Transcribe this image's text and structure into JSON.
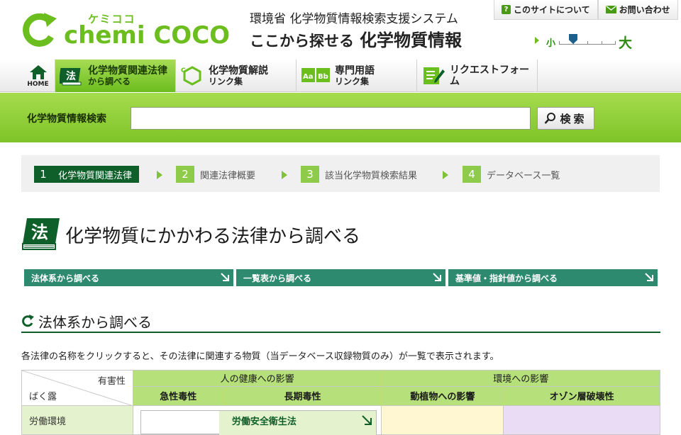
{
  "header": {
    "logo_kana": "ケミココ",
    "logo_word": "chemi COCO",
    "system_title": "環境省 化学物質情報検索支援システム",
    "tagline": "ここから探せる",
    "tagline_big": "化学物質情報",
    "top_links": [
      {
        "label": "このサイトについて",
        "icon": "question-icon"
      },
      {
        "label": "お問い合わせ",
        "icon": "mail-icon"
      }
    ],
    "font_size": {
      "small": "小",
      "large": "大"
    }
  },
  "nav": {
    "home": "HOME",
    "items": [
      {
        "line1": "化学物質関連法律",
        "line2": "から調べる",
        "icon": "law-book-icon"
      },
      {
        "line1": "化学物質解説",
        "line2": "リンク集",
        "icon": "hexagon-icon"
      },
      {
        "line1": "専門用語",
        "line2": "リンク集",
        "icon": "abc-book-icon"
      },
      {
        "line1": "リクエストフォーム",
        "line2": "",
        "icon": "form-pencil-icon"
      }
    ]
  },
  "search": {
    "label": "化学物質情報検索",
    "value": "",
    "button": "検索"
  },
  "steps": [
    {
      "num": "1",
      "label": "化学物質関連法律"
    },
    {
      "num": "2",
      "label": "関連法律概要"
    },
    {
      "num": "3",
      "label": "該当化学物質検索結果"
    },
    {
      "num": "4",
      "label": "データベース一覧"
    }
  ],
  "page_title": "化学物質にかかわる法律から調べる",
  "anchors": [
    "法体系から調べる",
    "一覧表から調べる",
    "基準値・指針値から調べる"
  ],
  "section": {
    "title": "法体系から調べる",
    "description": "各法律の名称をクリックすると、その法律に関連する物質（当データベース収録物質のみ）が一覧で表示されます。"
  },
  "table": {
    "corner_top": "有害性",
    "corner_bottom": "ばく露",
    "group_health": "人の健康への影響",
    "group_env": "環境への影響",
    "cols": [
      "急性毒性",
      "長期毒性",
      "動植物への影響",
      "オゾン層破壊性"
    ],
    "rows": [
      {
        "label": "労働環境",
        "law": "労働安全衛生法"
      }
    ]
  },
  "colors": {
    "brand_green": "#6cbd1e",
    "dark_green": "#0f5f2a",
    "teal": "#2e8a6f"
  }
}
